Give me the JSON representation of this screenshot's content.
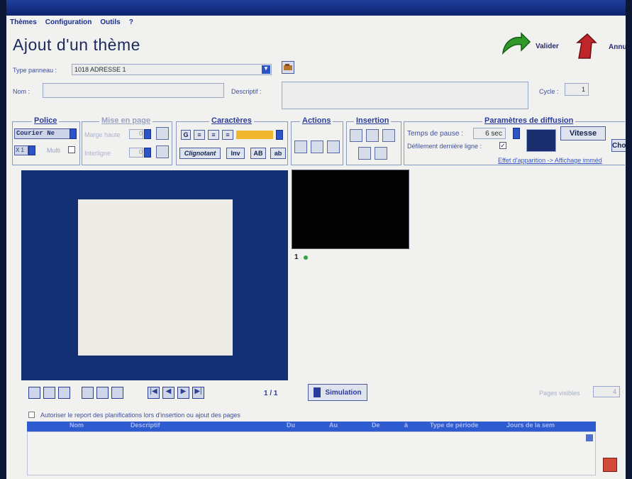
{
  "menu": {
    "themes": "Thèmes",
    "configuration": "Configuration",
    "outils": "Outils",
    "help": "?"
  },
  "page": {
    "title": "Ajout d'un thème"
  },
  "actions": {
    "valider": "Valider",
    "annuler": "Annuler"
  },
  "form": {
    "type_panneau_label": "Type panneau :",
    "type_panneau_value": "1018 ADRESSE 1",
    "nom_label": "Nom :",
    "nom_value": "",
    "descriptif_label": "Descriptif :",
    "descriptif_value": "",
    "cycle_label": "Cycle :",
    "cycle_value": "1"
  },
  "groups": {
    "police": "Police",
    "mise_en_page": "Mise en page",
    "caracteres": "Caractères",
    "actions": "Actions",
    "insertion": "Insertion",
    "diffusion": "Paramètres de diffusion"
  },
  "police": {
    "font": "Courier Ne",
    "size": "X 1",
    "multi": "Multi"
  },
  "mise_en_page": {
    "marge_haute": "Marge haute",
    "marge_value": "0",
    "interligne": "Interligne",
    "interligne_value": "0"
  },
  "caracteres": {
    "bold": "G",
    "clignotant": "Clignotant",
    "inv": "Inv",
    "upper": "AB",
    "lower": "ab",
    "color": "#f1b82f"
  },
  "diffusion": {
    "temps_pause_label": "Temps de pause :",
    "temps_pause_value": "6 sec",
    "defilement_label": "Défilement dernière ligne :",
    "vitesse": "Vitesse",
    "choisir": "Choi",
    "effet": "Effet d'apparition -> Affichage imméd"
  },
  "thumbnail": {
    "page_number": "1"
  },
  "navigation": {
    "page_counter": "1 / 1",
    "simulation": "Simulation",
    "pages_visibles_label": "Pages visibles",
    "pages_visibles_value": "4"
  },
  "option": {
    "autoriser_report": "Autoriser le report des planifications lors d'insertion ou ajout des pages"
  },
  "grid": {
    "columns": [
      "Nom",
      "Descriptif",
      "Du",
      "Au",
      "De",
      "à",
      "Type de période",
      "Jours de la sem"
    ]
  },
  "colors": {
    "preview_frame": "#123073",
    "accent_blue": "#2e5bd0",
    "valider_green": "#2f9a2a",
    "annuler_red": "#c0252a"
  }
}
